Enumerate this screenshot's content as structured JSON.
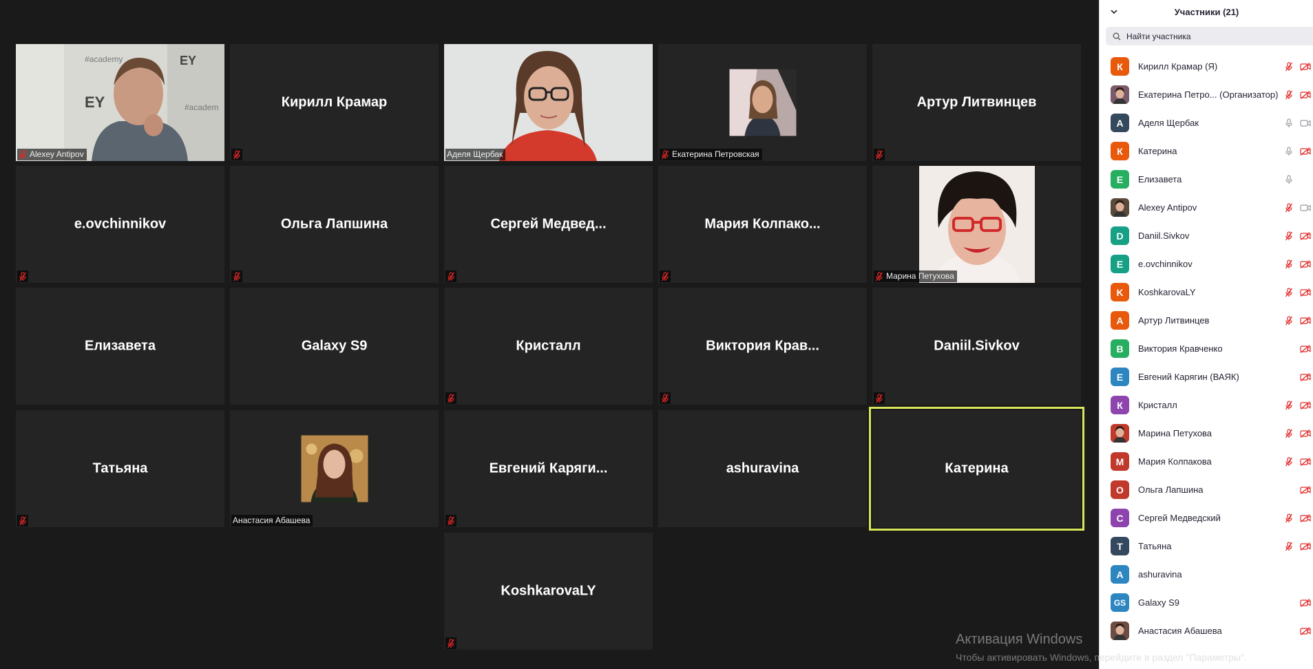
{
  "window": {
    "title": "Участники (21)"
  },
  "grid": {
    "tiles": [
      {
        "row": 0,
        "col": 0,
        "type": "video",
        "video": "ey",
        "tag": "Alexey Antipov",
        "muted": true
      },
      {
        "row": 0,
        "col": 1,
        "type": "name",
        "name": "Кирилл Крамар",
        "muted": true
      },
      {
        "row": 0,
        "col": 2,
        "type": "video",
        "video": "woman-glasses",
        "tag": "Аделя Щербак",
        "muted": false
      },
      {
        "row": 0,
        "col": 3,
        "type": "avatar",
        "avatar": "ekaterina",
        "tag": "Екатерина Петровская",
        "muted": true
      },
      {
        "row": 0,
        "col": 4,
        "type": "name",
        "name": "Артур Литвинцев",
        "muted": true
      },
      {
        "row": 1,
        "col": 0,
        "type": "name",
        "name": "e.ovchinnikov",
        "muted": true
      },
      {
        "row": 1,
        "col": 1,
        "type": "name",
        "name": "Ольга Лапшина",
        "muted": true
      },
      {
        "row": 1,
        "col": 2,
        "type": "name",
        "name": "Сергей Медвед...",
        "muted": true
      },
      {
        "row": 1,
        "col": 3,
        "type": "name",
        "name": "Мария Колпако...",
        "muted": true
      },
      {
        "row": 1,
        "col": 4,
        "type": "avatar",
        "avatar": "marina",
        "tag": "Марина Петухова",
        "muted": true
      },
      {
        "row": 2,
        "col": 0,
        "type": "name",
        "name": "Елизавета",
        "muted": false
      },
      {
        "row": 2,
        "col": 1,
        "type": "name",
        "name": "Galaxy S9",
        "muted": false
      },
      {
        "row": 2,
        "col": 2,
        "type": "name",
        "name": "Кристалл",
        "muted": true
      },
      {
        "row": 2,
        "col": 3,
        "type": "name",
        "name": "Виктория Крав...",
        "muted": true
      },
      {
        "row": 2,
        "col": 4,
        "type": "name",
        "name": "Daniil.Sivkov",
        "muted": true
      },
      {
        "row": 3,
        "col": 0,
        "type": "name",
        "name": "Татьяна",
        "muted": true
      },
      {
        "row": 3,
        "col": 1,
        "type": "avatar",
        "avatar": "anastasia",
        "tag": "Анастасия Абашева",
        "muted": false
      },
      {
        "row": 3,
        "col": 2,
        "type": "name",
        "name": "Евгений Каряги...",
        "muted": true
      },
      {
        "row": 3,
        "col": 3,
        "type": "name",
        "name": "ashuravina",
        "muted": false
      },
      {
        "row": 3,
        "col": 4,
        "type": "name",
        "name": "Катерина",
        "muted": false,
        "active": true
      },
      {
        "row": 4,
        "col": 2,
        "type": "name",
        "name": "KoshkarovaLY",
        "muted": true
      }
    ]
  },
  "panel": {
    "title": "Участники (21)",
    "search_placeholder": "Найти участника",
    "participants": [
      {
        "initial": "К",
        "color": "#e8590c",
        "name": "Кирилл Крамар (Я)",
        "mic": "muted",
        "cam": "off"
      },
      {
        "initial": "",
        "color": "#7a5a6a",
        "photo": true,
        "name": "Екатерина Петро... (Организатор)",
        "mic": "muted",
        "cam": "off"
      },
      {
        "initial": "А",
        "color": "#34495e",
        "name": "Аделя Щербак",
        "mic": "on",
        "cam": "on"
      },
      {
        "initial": "К",
        "color": "#e8590c",
        "name": "Катерина",
        "mic": "on",
        "cam": "off"
      },
      {
        "initial": "Е",
        "color": "#27ae60",
        "name": "Елизавета",
        "mic": "on",
        "cam": "none"
      },
      {
        "initial": "",
        "color": "#5a4a3a",
        "photo": true,
        "name": "Alexey Antipov",
        "mic": "muted",
        "cam": "on"
      },
      {
        "initial": "D",
        "color": "#16a085",
        "name": "Daniil.Sivkov",
        "mic": "muted",
        "cam": "off"
      },
      {
        "initial": "E",
        "color": "#16a085",
        "name": "e.ovchinnikov",
        "mic": "muted",
        "cam": "off"
      },
      {
        "initial": "K",
        "color": "#e8590c",
        "name": "KoshkarovaLY",
        "mic": "muted",
        "cam": "off"
      },
      {
        "initial": "А",
        "color": "#e8590c",
        "name": "Артур Литвинцев",
        "mic": "muted",
        "cam": "off"
      },
      {
        "initial": "В",
        "color": "#27ae60",
        "name": "Виктория Кравченко",
        "mic": "none",
        "cam": "off"
      },
      {
        "initial": "Е",
        "color": "#2e86c1",
        "name": "Евгений Карягин (ВАЯК)",
        "mic": "none",
        "cam": "off"
      },
      {
        "initial": "К",
        "color": "#8e44ad",
        "name": "Кристалл",
        "mic": "muted",
        "cam": "off"
      },
      {
        "initial": "",
        "color": "#c0392b",
        "photo": true,
        "name": "Марина Петухова",
        "mic": "muted",
        "cam": "off"
      },
      {
        "initial": "М",
        "color": "#c0392b",
        "name": "Мария Колпакова",
        "mic": "muted",
        "cam": "off"
      },
      {
        "initial": "О",
        "color": "#c0392b",
        "name": "Ольга Лапшина",
        "mic": "none",
        "cam": "off"
      },
      {
        "initial": "С",
        "color": "#8e44ad",
        "name": "Сергей Медведский",
        "mic": "muted",
        "cam": "off"
      },
      {
        "initial": "Т",
        "color": "#34495e",
        "name": "Татьяна",
        "mic": "muted",
        "cam": "off"
      },
      {
        "initial": "A",
        "color": "#2e86c1",
        "name": "ashuravina",
        "mic": "none",
        "cam": "none"
      },
      {
        "initial": "GS",
        "color": "#2e86c1",
        "name": "Galaxy S9",
        "mic": "none",
        "cam": "off"
      },
      {
        "initial": "",
        "color": "#6d4c41",
        "photo": true,
        "name": "Анастасия Абашева",
        "mic": "none",
        "cam": "off"
      }
    ]
  },
  "watermark": {
    "line1": "Активация Windows",
    "line2": "Чтобы активировать Windows, перейдите в раздел \"Параметры\"."
  },
  "colors": {
    "mute_red": "#e02828",
    "active_border": "#d8e65a",
    "tile_bg": "#242424"
  }
}
